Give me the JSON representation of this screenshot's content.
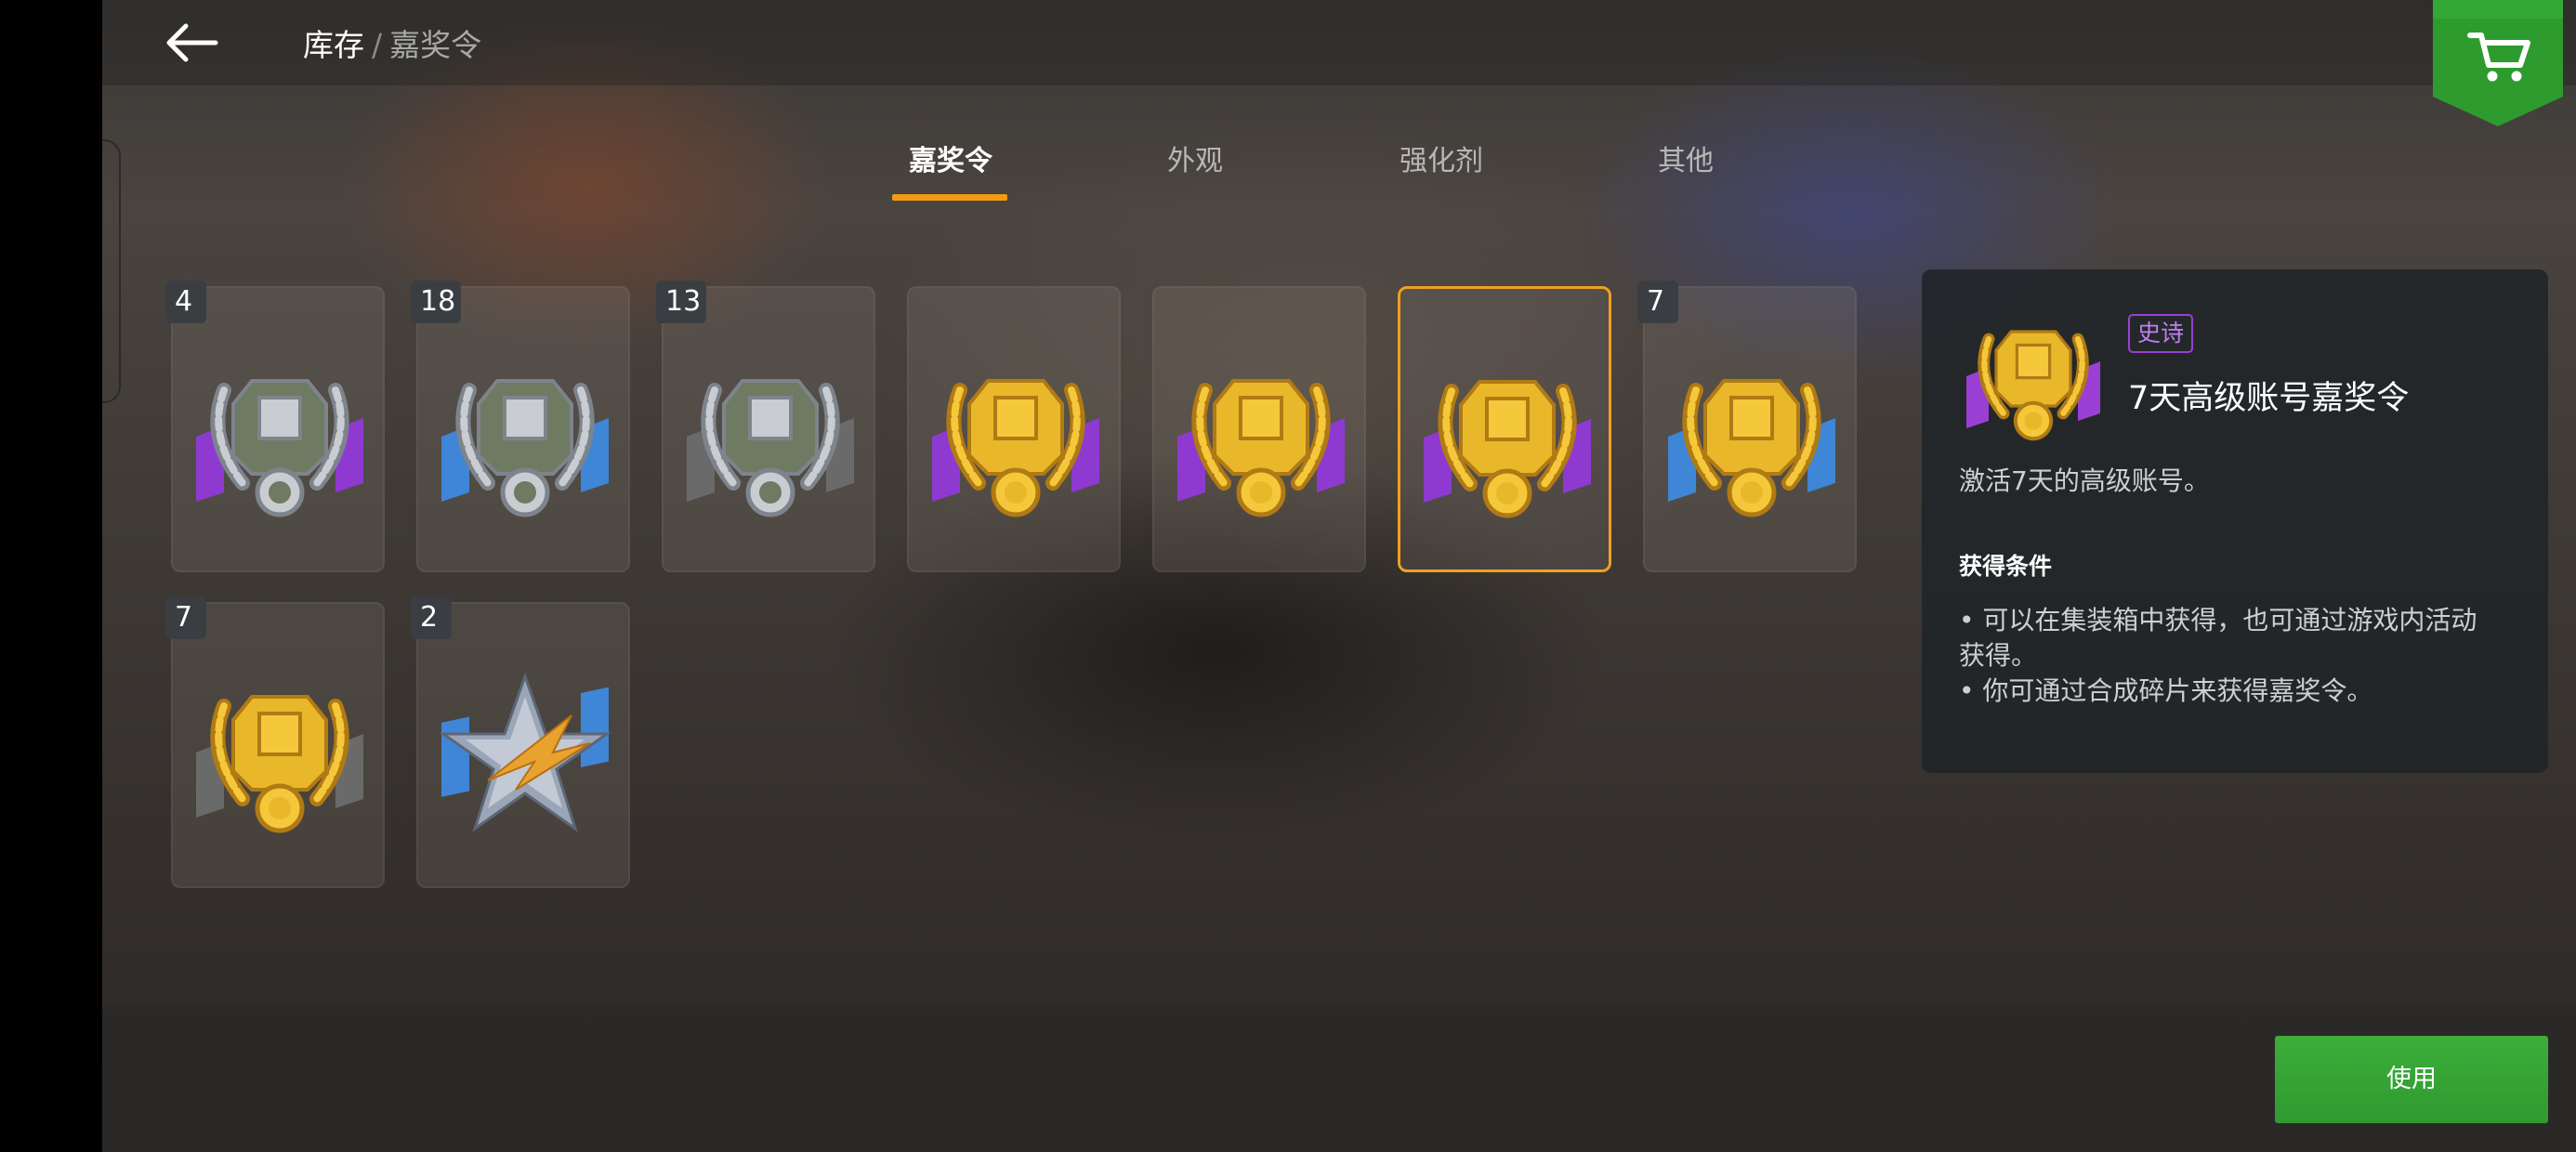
{
  "breadcrumb": {
    "root": "库存",
    "separator": "/",
    "current": "嘉奖令"
  },
  "tabs": [
    {
      "label": "嘉奖令",
      "active": true
    },
    {
      "label": "外观",
      "active": false
    },
    {
      "label": "强化剂",
      "active": false
    },
    {
      "label": "其他",
      "active": false
    }
  ],
  "items": [
    {
      "count": "4",
      "medal": "silver-laurel-medal",
      "ribbon": "#8e3ad0",
      "selected": false
    },
    {
      "count": "18",
      "medal": "silver-laurel-medal",
      "ribbon": "#3f86d6",
      "selected": false
    },
    {
      "count": "13",
      "medal": "silver-laurel-medal",
      "ribbon": "#6a6a6a",
      "selected": false
    },
    {
      "count": "",
      "medal": "gold-laurel-medal",
      "ribbon": "#8e3ad0",
      "selected": false
    },
    {
      "count": "",
      "medal": "gold-laurel-medal",
      "ribbon": "#8e3ad0",
      "selected": false
    },
    {
      "count": "",
      "medal": "gold-laurel-medal",
      "ribbon": "#8e3ad0",
      "selected": true
    },
    {
      "count": "7",
      "medal": "gold-laurel-medal",
      "ribbon": "#3f86d6",
      "selected": false
    },
    {
      "count": "7",
      "medal": "gold-laurel-medal",
      "ribbon": "#6a6a6a",
      "selected": false
    },
    {
      "count": "2",
      "medal": "star-badge",
      "ribbon": "#3f86d6",
      "selected": false
    }
  ],
  "detail": {
    "rarity": "史诗",
    "title": "7天高级账号嘉奖令",
    "description": "激活7天的高级账号。",
    "conditions_title": "获得条件",
    "conditions": [
      "• 可以在集装箱中获得，也可通过游戏内活动",
      "获得。",
      "• 你可通过合成碎片来获得嘉奖令。"
    ],
    "rarity_color": "#9b3fd4"
  },
  "use_button": "使用",
  "colors": {
    "accent": "#f39c12",
    "use_green": "#34a234",
    "cart_green": "#2e9b2e"
  }
}
